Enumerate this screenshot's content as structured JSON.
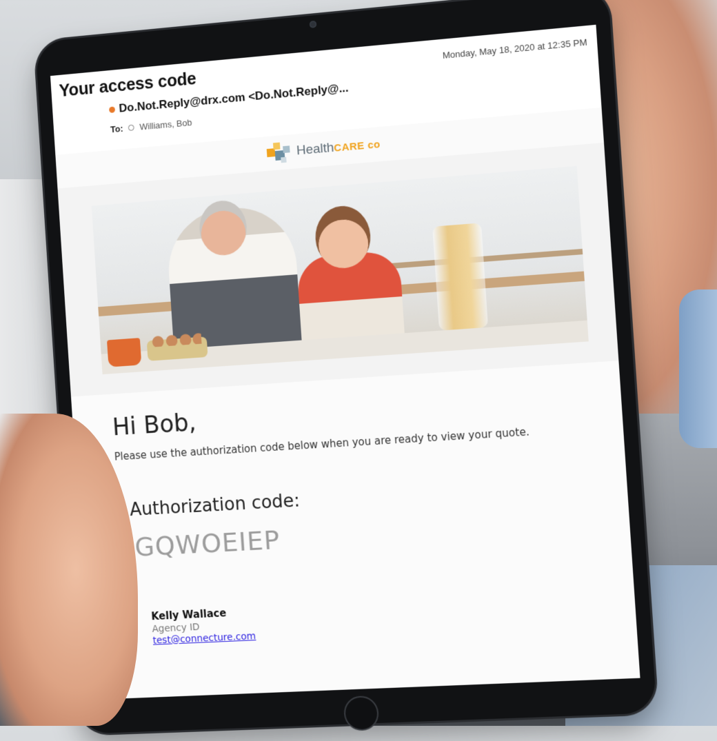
{
  "email": {
    "subject": "Your access code",
    "date": "Monday, May 18, 2020 at 12:35 PM",
    "from": "Do.Not.Reply@drx.com <Do.Not.Reply@...",
    "to_label": "To:",
    "to": "Williams, Bob"
  },
  "brand": {
    "name_part1": "Health",
    "name_part2": "CARE co",
    "accent_color": "#f0a31e"
  },
  "body": {
    "greeting": "Hi Bob,",
    "message": "Please use the authorization code below when you are ready to view your quote.",
    "auth_label": "Authorization code:",
    "auth_code": "GQWOEIEP"
  },
  "signature": {
    "name": "Kelly Wallace",
    "agency": "Agency ID",
    "email": "test@connecture.com"
  }
}
